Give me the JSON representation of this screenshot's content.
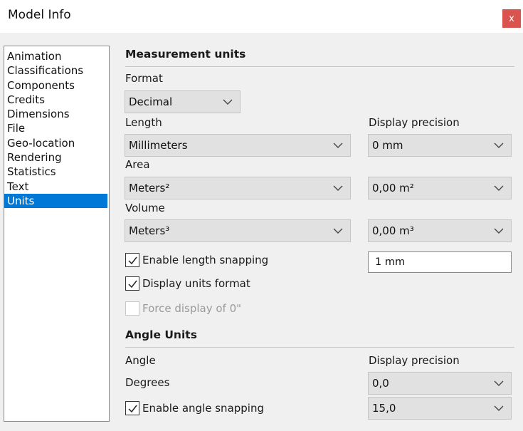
{
  "window": {
    "title": "Model Info",
    "close_label": "x"
  },
  "nav": {
    "items": [
      "Animation",
      "Classifications",
      "Components",
      "Credits",
      "Dimensions",
      "File",
      "Geo-location",
      "Rendering",
      "Statistics",
      "Text",
      "Units"
    ],
    "selected": "Units"
  },
  "measurement": {
    "title": "Measurement units",
    "format_label": "Format",
    "format_value": "Decimal",
    "length_label": "Length",
    "length_value": "Millimeters",
    "display_precision_label": "Display precision",
    "length_precision": "0 mm",
    "area_label": "Area",
    "area_value": "Meters²",
    "area_precision": "0,00 m²",
    "volume_label": "Volume",
    "volume_value": "Meters³",
    "volume_precision": "0,00 m³",
    "length_snapping_label": "Enable length snapping",
    "length_snapping_checked": true,
    "length_snapping_value": "1 mm",
    "display_units_format_label": "Display units format",
    "display_units_format_checked": true,
    "force_display_label": "Force display of 0\"",
    "force_display_checked": false,
    "force_display_disabled": true
  },
  "angle": {
    "title": "Angle Units",
    "angle_label": "Angle",
    "display_precision_label": "Display precision",
    "degrees_label": "Degrees",
    "degrees_precision": "0,0",
    "angle_snapping_label": "Enable angle snapping",
    "angle_snapping_checked": true,
    "angle_snapping_value": "15,0"
  },
  "colors": {
    "selection": "#0078d7",
    "close_button": "#d9534f"
  }
}
